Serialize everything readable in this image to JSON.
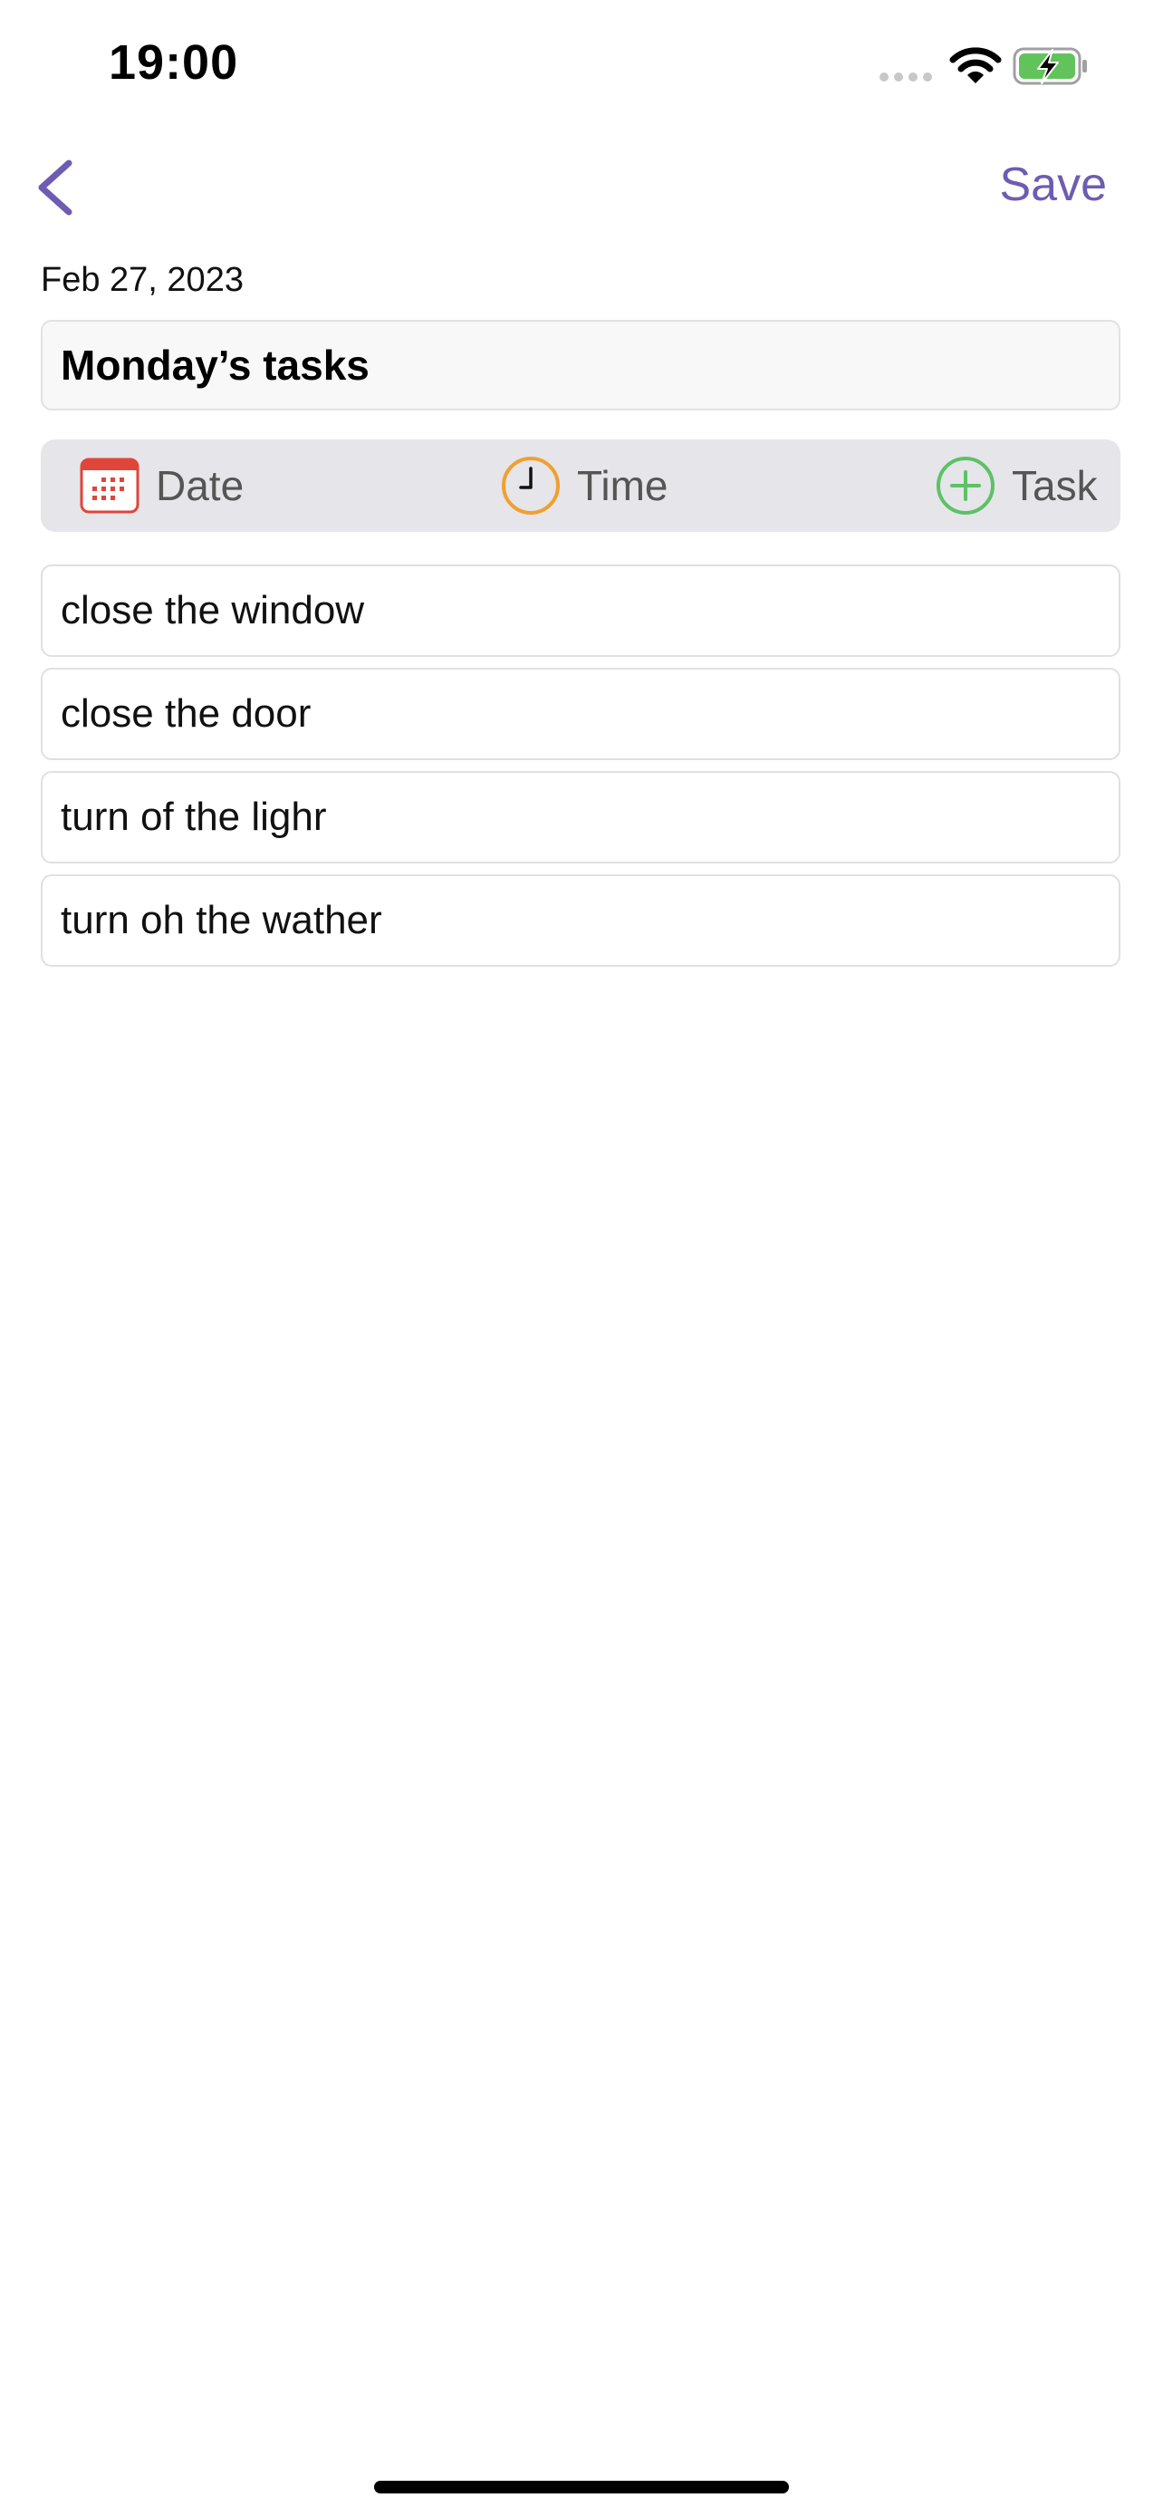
{
  "status_bar": {
    "time": "19:00",
    "icons": [
      "signal-dots-icon",
      "wifi-icon",
      "battery-charging-icon"
    ]
  },
  "nav": {
    "back_icon": "chevron-left-icon",
    "save_label": "Save"
  },
  "date_text": "Feb 27, 2023",
  "title": "Monday’s tasks",
  "toolbar": {
    "date_label": "Date",
    "time_label": "Time",
    "task_label": "Task"
  },
  "tasks": [
    "close the window",
    "close the door",
    "turn of the lighr",
    "turn oh the wather"
  ],
  "colors": {
    "accent": "#6e5cb2",
    "calendar_red": "#e0453a",
    "clock_orange": "#f0a030",
    "add_green": "#5cc265",
    "battery_green": "#62c35c",
    "toolbar_bg": "#e5e5ea"
  }
}
